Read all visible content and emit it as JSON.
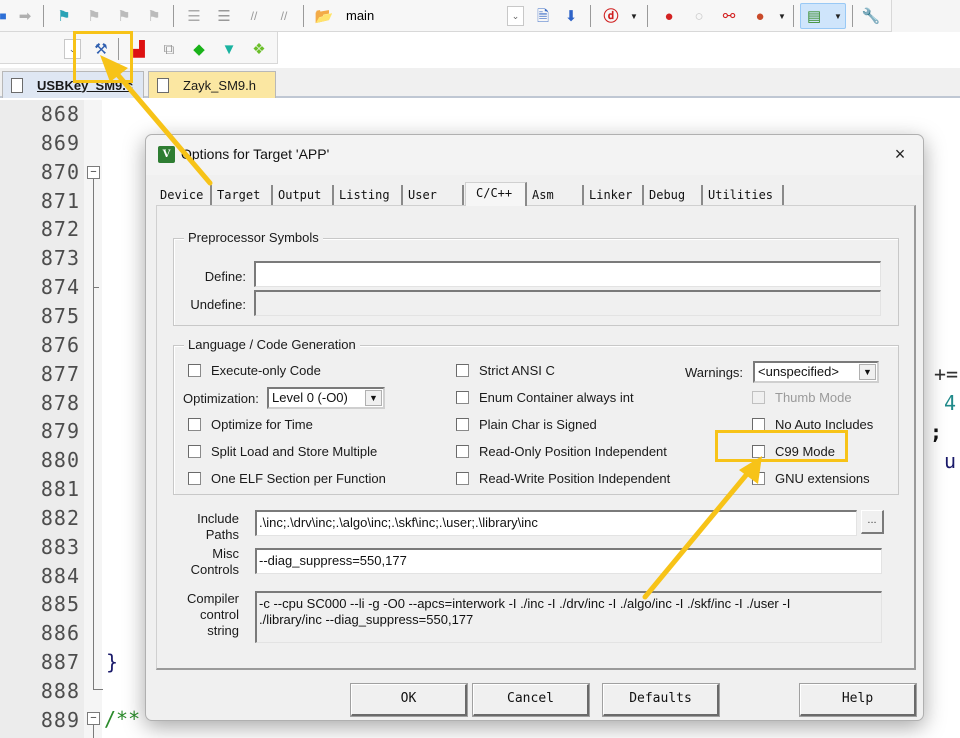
{
  "toolbar1": {
    "target_combo": "main",
    "icons": [
      "nav-back-icon",
      "nav-forward-icon",
      "bookmark-set-icon",
      "bookmark-prev-icon",
      "bookmark-next-icon",
      "bookmark-clear-icon",
      "indent-icon",
      "unindent-icon",
      "comment-icon",
      "uncomment-icon",
      "find-in-files-icon",
      "target-combo",
      "find-icon",
      "incremental-find-icon",
      "debug-session-icon",
      "breakpoint-insert-icon",
      "breakpoint-enable-icon",
      "breakpoint-disable-all-icon",
      "breakpoint-kill-all-icon",
      "window-layout-icon",
      "configure-icon"
    ]
  },
  "toolbar2": {
    "icons": [
      "dropdown-arrow",
      "options-for-target-icon",
      "file-extensions-icon",
      "manage-components-icon",
      "select-pack-icon",
      "pack-installer-icon",
      "software-packs-icon"
    ]
  },
  "file_tabs": [
    {
      "label": "USBKey_SM9.c",
      "active": true
    },
    {
      "label": "Zayk_SM9.h",
      "active": false
    }
  ],
  "editor": {
    "line_numbers": [
      "868",
      "869",
      "870",
      "871",
      "872",
      "873",
      "874",
      "875",
      "876",
      "877",
      "878",
      "879",
      "880",
      "881",
      "882",
      "883",
      "884",
      "885",
      "886",
      "887",
      "888",
      "889"
    ],
    "visible_code": {
      "line_887": "}",
      "line_889": "/**",
      "line_877_tail": "+=",
      "line_878_tail": "4",
      "line_879_tail": ";",
      "line_880_tail": "u"
    }
  },
  "dialog": {
    "title": "Options for Target 'APP'",
    "close_label": "×",
    "tabs": [
      "Device",
      "Target",
      "Output",
      "Listing",
      "User",
      "C/C++",
      "Asm",
      "Linker",
      "Debug",
      "Utilities"
    ],
    "active_tab": "C/C++",
    "preprocessor": {
      "legend": "Preprocessor Symbols",
      "define_label": "Define:",
      "define_value": "",
      "undefine_label": "Undefine:",
      "undefine_value": ""
    },
    "language": {
      "legend": "Language / Code Generation",
      "col1": [
        {
          "label": "Execute-only Code",
          "checked": false
        },
        {
          "label": "Optimize for Time",
          "checked": false
        },
        {
          "label": "Split Load and Store Multiple",
          "checked": false
        },
        {
          "label": "One ELF Section per Function",
          "checked": false
        }
      ],
      "optimization_label": "Optimization:",
      "optimization_value": "Level 0 (-O0)",
      "col2": [
        {
          "label": "Strict ANSI C",
          "checked": false
        },
        {
          "label": "Enum Container always int",
          "checked": false
        },
        {
          "label": "Plain Char is Signed",
          "checked": false
        },
        {
          "label": "Read-Only Position Independent",
          "checked": false
        },
        {
          "label": "Read-Write Position Independent",
          "checked": false
        }
      ],
      "warnings_label": "Warnings:",
      "warnings_value": "<unspecified>",
      "col3": [
        {
          "label": "Thumb Mode",
          "checked": false,
          "disabled": true
        },
        {
          "label": "No Auto Includes",
          "checked": false
        },
        {
          "label": "C99 Mode",
          "checked": false
        },
        {
          "label": "GNU extensions",
          "checked": false
        }
      ]
    },
    "include_paths_label": "Include\nPaths",
    "include_paths_label_1": "Include",
    "include_paths_label_2": "Paths",
    "include_paths_value": ".\\inc;.\\drv\\inc;.\\algo\\inc;.\\skf\\inc;.\\user;.\\library\\inc",
    "browse_label": "...",
    "misc_controls_label_1": "Misc",
    "misc_controls_label_2": "Controls",
    "misc_controls_value": "--diag_suppress=550,177",
    "compiler_control_label_1": "Compiler",
    "compiler_control_label_2": "control",
    "compiler_control_label_3": "string",
    "compiler_control_value": "-c --cpu SC000 --li -g -O0 --apcs=interwork -I ./inc -I ./drv/inc -I ./algo/inc -I ./skf/inc -I ./user -I ./library/inc --diag_suppress=550,177",
    "buttons": {
      "ok": "OK",
      "cancel": "Cancel",
      "defaults": "Defaults",
      "help": "Help"
    }
  },
  "annotations": {
    "highlight_color": "#f7c318"
  }
}
